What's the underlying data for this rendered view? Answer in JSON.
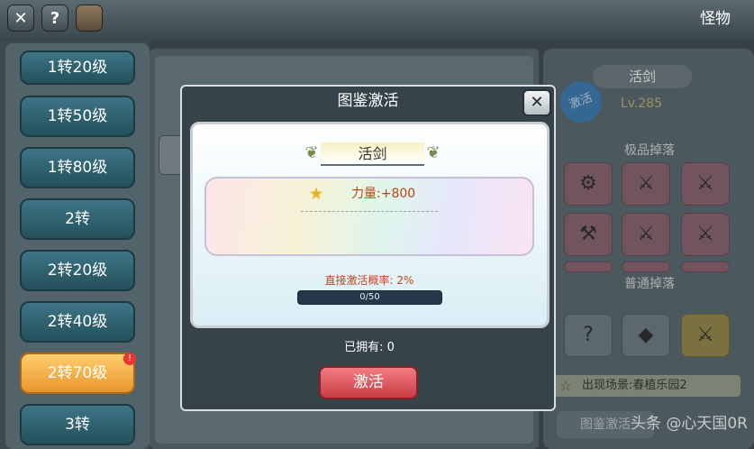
{
  "topbar": {
    "close_icon": "✕",
    "help_icon": "?",
    "title": "怪物"
  },
  "sidebar": {
    "items": [
      {
        "label": "1转20级"
      },
      {
        "label": "1转50级"
      },
      {
        "label": "1转80级"
      },
      {
        "label": "2转"
      },
      {
        "label": "2转20级"
      },
      {
        "label": "2转40级"
      },
      {
        "label": "2转70级"
      },
      {
        "label": "3转"
      }
    ],
    "selected": "2转70级",
    "badge": "!"
  },
  "right_panel": {
    "name": "活剑",
    "stamp": "激活",
    "level": "Lv.285",
    "section_premium": "极品掉落",
    "section_normal": "普通掉落",
    "scene": "出现场景:春植乐园2",
    "button": "图鉴激活"
  },
  "modal": {
    "title": "图鉴激活",
    "close_icon": "✕",
    "item_name": "活剑",
    "stat": "力量:+800",
    "rate": "直接激活概率: 2%",
    "progress_text": "0/50",
    "progress_fraction": 0.0,
    "owned": "已拥有: 0",
    "activate_button": "激活"
  },
  "watermark": "头条 @心天国0R",
  "colors": {
    "accent_red": "#d24750",
    "selected_orange": "#f0a33c",
    "teal_button": "#2f6675"
  }
}
